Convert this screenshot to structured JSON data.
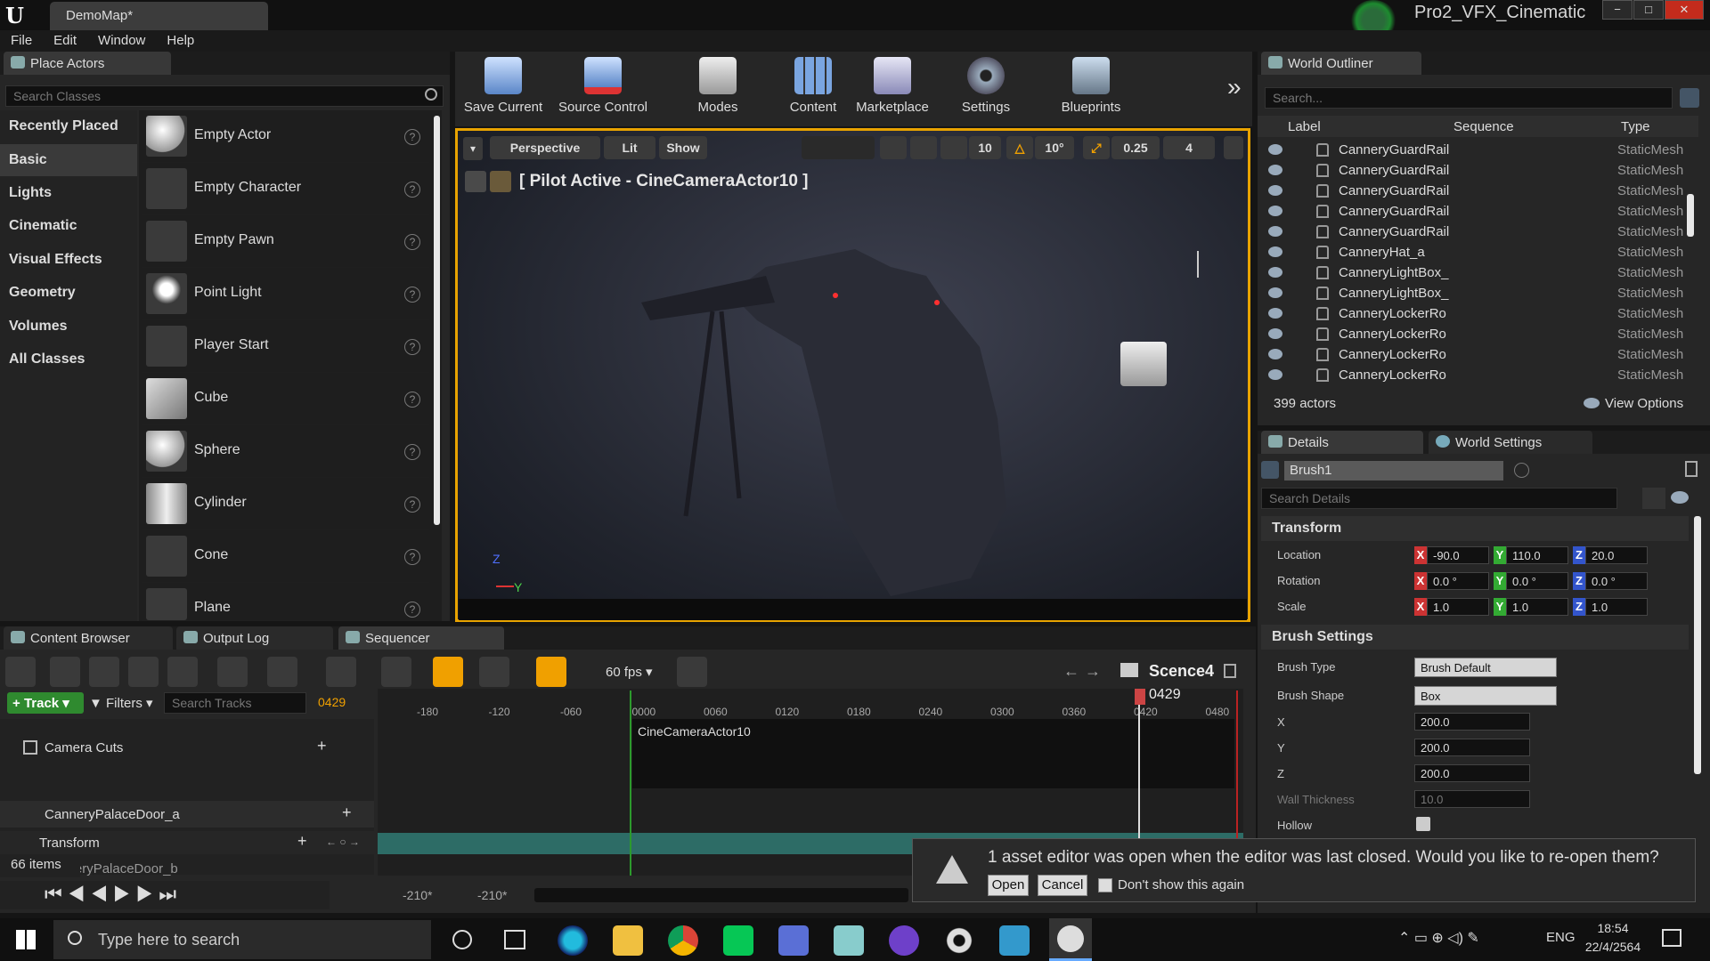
{
  "window": {
    "doc_tab": "DemoMap*",
    "project": "Pro2_VFX_Cinematic",
    "minimize": "−",
    "restore": "□",
    "close": "✕"
  },
  "menu": [
    "File",
    "Edit",
    "Window",
    "Help"
  ],
  "place_actors": {
    "tab_label": "Place Actors",
    "search_placeholder": "Search Classes",
    "categories": [
      "Recently Placed",
      "Basic",
      "Lights",
      "Cinematic",
      "Visual Effects",
      "Geometry",
      "Volumes",
      "All Classes"
    ],
    "selected_category": "Basic",
    "actors": [
      "Empty Actor",
      "Empty Character",
      "Empty Pawn",
      "Point Light",
      "Player Start",
      "Cube",
      "Sphere",
      "Cylinder",
      "Cone",
      "Plane"
    ],
    "help_glyph": "?"
  },
  "toolbar": {
    "buttons": [
      "Save Current",
      "Source Control",
      "Modes",
      "Content",
      "Marketplace",
      "Settings",
      "Blueprints"
    ],
    "more_glyph": "»"
  },
  "viewport": {
    "perspective": "Perspective",
    "lit": "Lit",
    "show": "Show",
    "grid_snap": "10",
    "rot_snap": "10°",
    "scale_snap": "0.25",
    "cam_speed": "4",
    "pilot_label": "[ Pilot Active - CineCameraActor10 ]",
    "axis_z": "Z",
    "axis_y": "Y"
  },
  "outliner": {
    "tab_label": "World Outliner",
    "search_placeholder": "Search...",
    "columns": [
      "Label",
      "Sequence",
      "Type"
    ],
    "rows": [
      {
        "name": "CanneryGuardRail",
        "type": "StaticMesh"
      },
      {
        "name": "CanneryGuardRail",
        "type": "StaticMesh"
      },
      {
        "name": "CanneryGuardRail",
        "type": "StaticMesh"
      },
      {
        "name": "CanneryGuardRail",
        "type": "StaticMesh"
      },
      {
        "name": "CanneryGuardRail",
        "type": "StaticMesh"
      },
      {
        "name": "CanneryHat_a",
        "type": "StaticMesh"
      },
      {
        "name": "CanneryLightBox_",
        "type": "StaticMesh"
      },
      {
        "name": "CanneryLightBox_",
        "type": "StaticMesh"
      },
      {
        "name": "CanneryLockerRo",
        "type": "StaticMesh"
      },
      {
        "name": "CanneryLockerRo",
        "type": "StaticMesh"
      },
      {
        "name": "CanneryLockerRo",
        "type": "StaticMesh"
      },
      {
        "name": "CanneryLockerRo",
        "type": "StaticMesh"
      }
    ],
    "actor_count": "399 actors",
    "view_options": "View Options"
  },
  "details": {
    "tab_details": "Details",
    "tab_world_settings": "World Settings",
    "object_name": "Brush1",
    "search_placeholder": "Search Details",
    "transform_header": "Transform",
    "location_label": "Location",
    "rotation_label": "Rotation",
    "scale_label": "Scale",
    "location": {
      "x": "-90.0",
      "y": "110.0",
      "z": "20.0"
    },
    "rotation": {
      "x": "0.0 °",
      "y": "0.0 °",
      "z": "0.0 °"
    },
    "scale": {
      "x": "1.0",
      "y": "1.0",
      "z": "1.0"
    },
    "axis_x": "X",
    "axis_y": "Y",
    "axis_z": "Z",
    "brush_header": "Brush Settings",
    "brush_type_label": "Brush Type",
    "brush_type": "Brush Default",
    "brush_shape_label": "Brush Shape",
    "brush_shape": "Box",
    "x_label": "X",
    "y_label": "Y",
    "z_label": "Z",
    "x": "200.0",
    "y": "200.0",
    "z": "200.0",
    "wall_label": "Wall Thickness",
    "wall": "10.0",
    "hollow_label": "Hollow"
  },
  "bottom_tabs": [
    "Content Browser",
    "Output Log",
    "Sequencer"
  ],
  "sequencer": {
    "fps": "60 fps",
    "sequence_name": "Scence4",
    "track_btn": "Track",
    "filters_btn": "Filters",
    "search_placeholder": "Search Tracks",
    "current_frame": "0429",
    "playhead_label": "0429",
    "ruler": [
      "-180",
      "-120",
      "-060",
      "0000",
      "0060",
      "0120",
      "0180",
      "0240",
      "0300",
      "0360",
      "0420",
      "0480"
    ],
    "tracks": {
      "camera_cuts": "Camera Cuts",
      "door_a": "CanneryPalaceDoor_a",
      "transform": "Transform",
      "door_b": "CanneryPalaceDoor_b"
    },
    "clip_label": "CineCameraActor10",
    "item_count": "66 items",
    "start_range": "-210*",
    "end_range": "-210*"
  },
  "notification": {
    "message": "1 asset editor was open when the editor was last closed. Would you like to re-open them?",
    "open": "Open",
    "cancel": "Cancel",
    "dont_show": "Don't show this again"
  },
  "taskbar": {
    "search_placeholder": "Type here to search",
    "language": "ENG",
    "time": "18:54",
    "date": "22/4/2564"
  },
  "colors": {
    "accent": "#f0a000",
    "selected_blue": "#2a5fa8",
    "ue_bg": "#262626"
  }
}
